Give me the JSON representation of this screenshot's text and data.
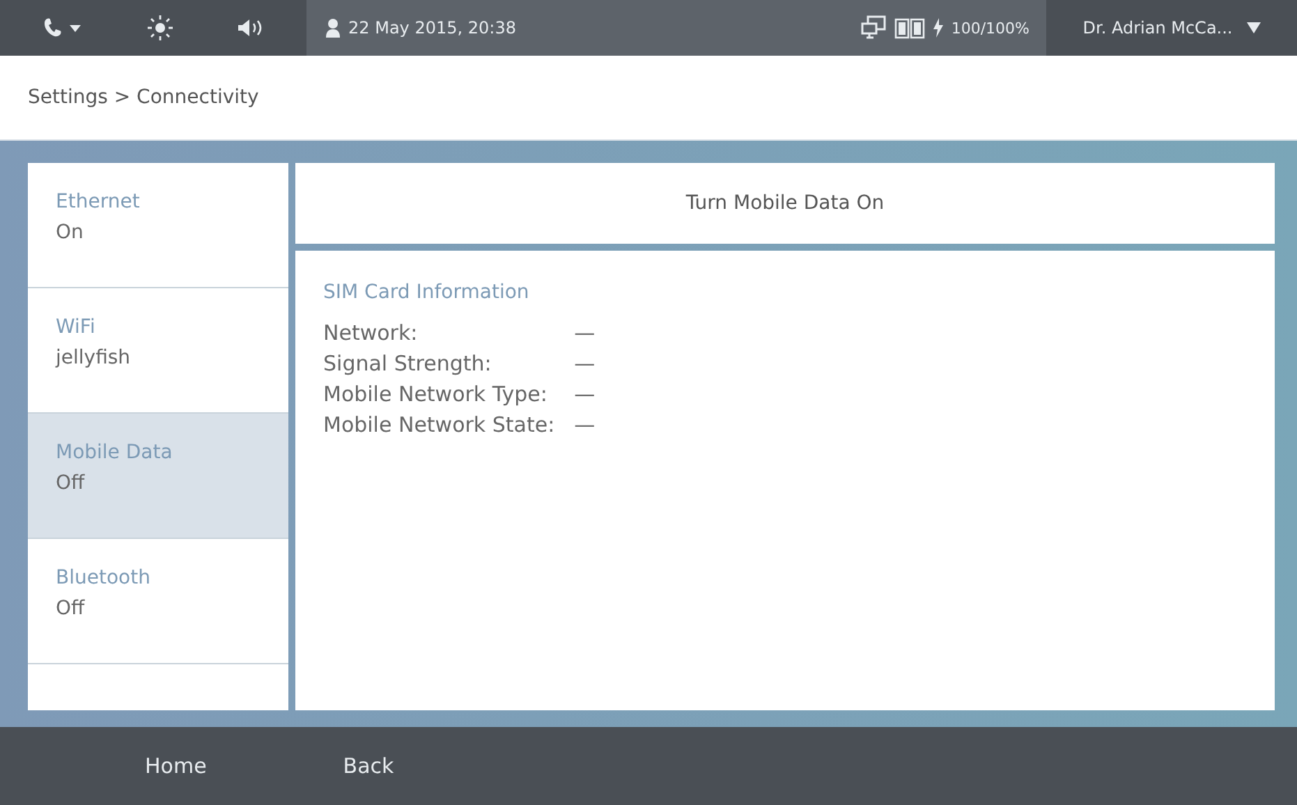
{
  "status_bar": {
    "date_time": "22 May 2015, 20:38",
    "battery": "100/100%",
    "user": "Dr. Adrian McCa..."
  },
  "breadcrumb": "Settings > Connectivity",
  "sidebar": {
    "items": [
      {
        "label": "Ethernet",
        "value": "On",
        "selected": false
      },
      {
        "label": "WiFi",
        "value": "jellyfish",
        "selected": false
      },
      {
        "label": "Mobile Data",
        "value": "Off",
        "selected": true
      },
      {
        "label": "Bluetooth",
        "value": "Off",
        "selected": false
      }
    ]
  },
  "toggle_button": "Turn Mobile Data On",
  "sim_info": {
    "title": "SIM Card Information",
    "rows": [
      {
        "label": "Network:",
        "value": "—"
      },
      {
        "label": "Signal Strength:",
        "value": "—"
      },
      {
        "label": "Mobile Network Type:",
        "value": "—"
      },
      {
        "label": "Mobile Network State:",
        "value": "—"
      }
    ]
  },
  "footer": {
    "buttons": [
      "Home",
      "Back"
    ]
  }
}
